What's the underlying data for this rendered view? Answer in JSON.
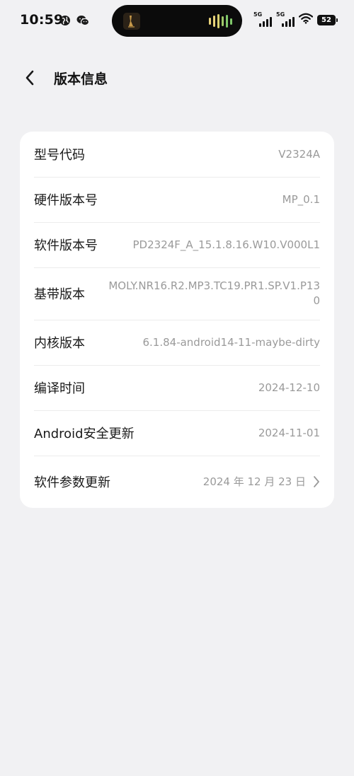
{
  "status_bar": {
    "time": "10:59",
    "signal_1_label": "5G",
    "signal_2_label": "5G",
    "battery": "52"
  },
  "header": {
    "title": "版本信息"
  },
  "rows": [
    {
      "label": "型号代码",
      "value": "V2324A"
    },
    {
      "label": "硬件版本号",
      "value": "MP_0.1"
    },
    {
      "label": "软件版本号",
      "value": "PD2324F_A_15.1.8.16.W10.V000L1"
    },
    {
      "label": "基带版本",
      "value": "MOLY.NR16.R2.MP3.TC19.PR1.SP.V1.P130"
    },
    {
      "label": "内核版本",
      "value": "6.1.84-android14-11-maybe-dirty"
    },
    {
      "label": "编译时间",
      "value": "2024-12-10"
    },
    {
      "label": "Android安全更新",
      "value": "2024-11-01"
    },
    {
      "label": "软件参数更新",
      "value": "2024 年 12 月 23 日"
    }
  ],
  "icons": {
    "back": "back-arrow-icon",
    "chevron": "chevron-right-icon",
    "wifi": "wifi-icon",
    "wechat": "wechat-icon",
    "browser": "globe-icon"
  }
}
